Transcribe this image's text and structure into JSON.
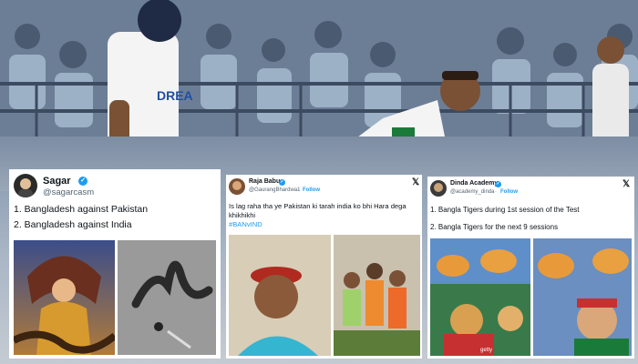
{
  "background": {
    "jersey_sponsor": "DREA",
    "description_colors": {
      "sky": "#5b6f87",
      "jersey": "#f4f4f4",
      "cap": "#1f2a44"
    }
  },
  "tweets": [
    {
      "name": "Sagar",
      "handle": "@sagarcasm",
      "lines": [
        "1. Bangladesh against Pakistan",
        "2. Bangladesh against India"
      ],
      "images": [
        "snake-queen-illustration",
        "burnt-snake-photo"
      ]
    },
    {
      "name": "Raja Babu",
      "handle": "@GaurangBhardwa1",
      "follow": "Follow",
      "text": "Is lag raha tha ye Pakistan ki tarah india ko bhi Hara dega khikhikhi",
      "hashtag": "#BANvIND",
      "images": [
        "cap-man-meme",
        "group-laughing-photo"
      ]
    },
    {
      "name": "Dinda Academy",
      "handle": "@academy_dinda",
      "follow": "Follow",
      "lines": [
        "1. Bangla Tigers during 1st session of the Test",
        "2. Bangla Tigers for the next 9 sessions"
      ],
      "images": [
        "tiger-fans-photo",
        "tiger-fan-face-photo"
      ],
      "watermark": "getty"
    }
  ],
  "colors": {
    "accent": "#1d9bf0",
    "text": "#0f1419",
    "muted": "#536471"
  }
}
